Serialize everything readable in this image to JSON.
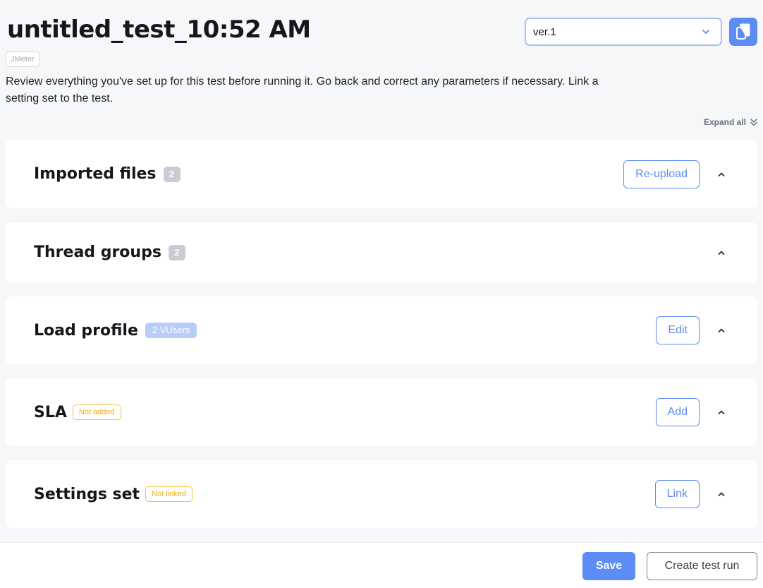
{
  "header": {
    "title": "untitled_test_10:52 AM",
    "type_badge": "JMeter",
    "description": "Review everything you've set up for this test before running it. Go back and correct any parameters if necessary. Link a setting set to the test.",
    "version_selected": "ver.1",
    "expand_all_label": "Expand all"
  },
  "sections": {
    "imported_files": {
      "title": "Imported files",
      "badge": "2",
      "action": "Re-upload"
    },
    "thread_groups": {
      "title": "Thread groups",
      "badge": "2"
    },
    "load_profile": {
      "title": "Load profile",
      "badge": "2 VUsers",
      "action": "Edit"
    },
    "sla": {
      "title": "SLA",
      "badge": "Not added",
      "action": "Add"
    },
    "settings_set": {
      "title": "Settings set",
      "badge": "Not linked",
      "action": "Link"
    }
  },
  "footer": {
    "save_label": "Save",
    "create_run_label": "Create test run"
  },
  "colors": {
    "accent": "#5c8cf4",
    "warning": "#f5c33b",
    "badge_gray": "#c9ccd5",
    "background": "#f6f7f8"
  },
  "icons": {
    "version_dropdown": "chevron-down-icon",
    "copy": "copy-icon",
    "expand_all": "double-chevron-down-icon",
    "section_toggle": "chevron-up-icon"
  }
}
